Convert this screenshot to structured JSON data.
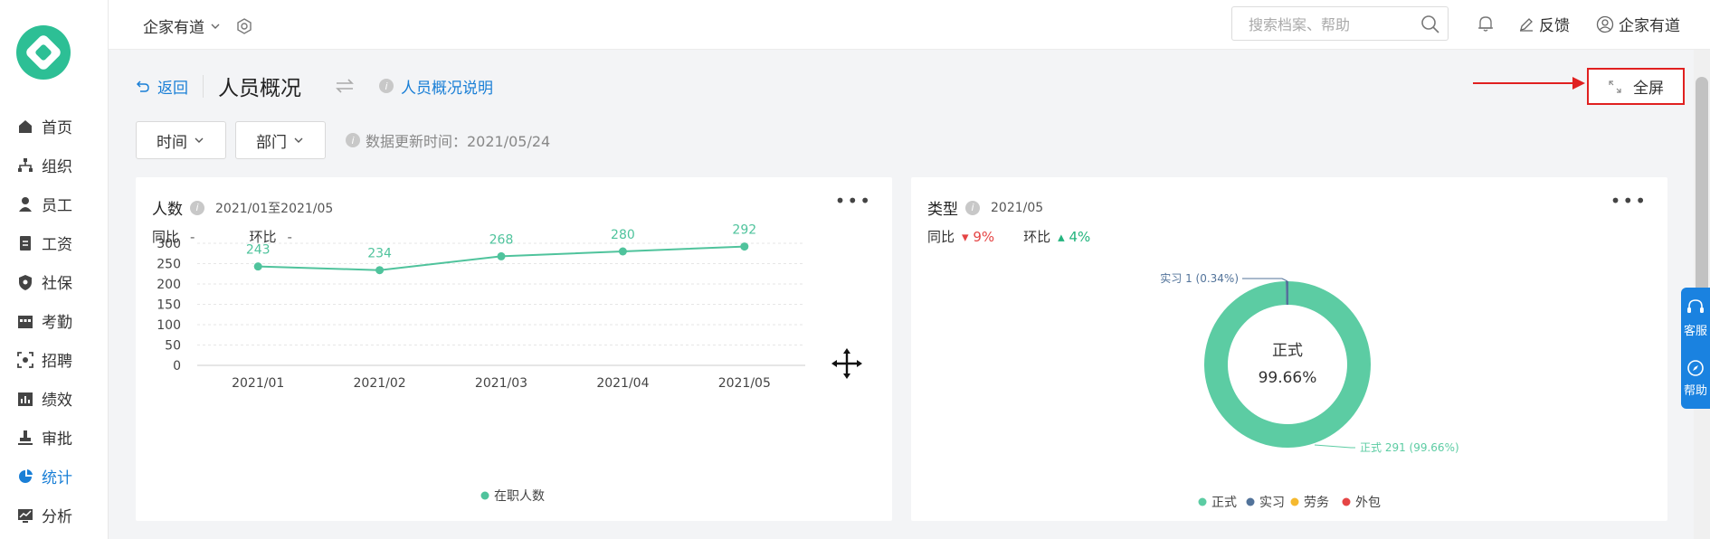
{
  "sidebar": {
    "items": [
      {
        "label": "首页",
        "icon": "home-icon"
      },
      {
        "label": "组织",
        "icon": "org-icon"
      },
      {
        "label": "员工",
        "icon": "user-icon"
      },
      {
        "label": "工资",
        "icon": "salary-icon"
      },
      {
        "label": "社保",
        "icon": "shield-icon"
      },
      {
        "label": "考勤",
        "icon": "calendar-icon"
      },
      {
        "label": "招聘",
        "icon": "recruit-icon"
      },
      {
        "label": "绩效",
        "icon": "bar-chart-icon"
      },
      {
        "label": "审批",
        "icon": "stamp-icon"
      },
      {
        "label": "统计",
        "icon": "pie-icon",
        "active": true
      },
      {
        "label": "分析",
        "icon": "analysis-icon"
      }
    ]
  },
  "topbar": {
    "company": "企家有道",
    "search_placeholder": "搜索档案、帮助",
    "feedback": "反馈",
    "user": "企家有道"
  },
  "header": {
    "back": "返回",
    "title": "人员概况",
    "explain": "人员概况说明",
    "fullscreen": "全屏"
  },
  "filters": {
    "time": "时间",
    "dept": "部门",
    "updated": "数据更新时间：2021/05/24"
  },
  "card1": {
    "title": "人数",
    "period": "2021/01至2021/05",
    "yoy_label": "同比",
    "yoy_value": "-",
    "mom_label": "环比",
    "mom_value": "-"
  },
  "card2": {
    "title": "类型",
    "period": "2021/05",
    "yoy_label": "同比",
    "yoy_value": "9%",
    "mom_label": "环比",
    "mom_value": "4%",
    "center_label": "正式",
    "center_value": "99.66%",
    "callout_top": "实习 1 (0.34%)",
    "callout_bottom": "正式 291 (99.66%)"
  },
  "floatbar": {
    "service": "客服",
    "help": "帮助"
  },
  "chart_data": [
    {
      "type": "line",
      "categories": [
        "2021/01",
        "2021/02",
        "2021/03",
        "2021/04",
        "2021/05"
      ],
      "series": [
        {
          "name": "在职人数",
          "values": [
            243,
            234,
            268,
            280,
            292
          ]
        }
      ],
      "ylim": [
        0,
        300
      ],
      "yticks": [
        0,
        50,
        100,
        150,
        200,
        250,
        300
      ],
      "grid": true,
      "legend": "bottom",
      "color": "#4fc39c"
    },
    {
      "type": "pie",
      "labels": [
        "正式",
        "实习",
        "劳务",
        "外包"
      ],
      "values": [
        291,
        1,
        0,
        0
      ],
      "colors": [
        "#5ccca3",
        "#52739a",
        "#f5b92f",
        "#e54545"
      ],
      "donut": true,
      "legend": "bottom"
    }
  ]
}
